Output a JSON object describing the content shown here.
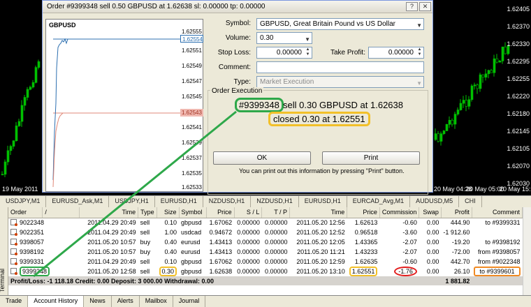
{
  "dialog": {
    "title": "Order #9399348 sell 0.50 GBPUSD at 1.62638 sl: 0.00000 tp: 0.00000",
    "labels": {
      "symbol": "Symbol:",
      "volume": "Volume:",
      "stop_loss": "Stop Loss:",
      "take_profit": "Take Profit:",
      "comment": "Comment:",
      "type": "Type:"
    },
    "symbol_value": "GBPUSD, Great Britain Pound vs US Dollar",
    "volume_value": "0.30",
    "stop_loss_value": "0.00000",
    "take_profit_value": "0.00000",
    "comment_value": "",
    "type_value": "Market Execution",
    "execution_legend": "Order Execution",
    "order_number": "#9399348",
    "order_rest": "sell 0.30 GBPUSD at 1.62638",
    "closed_text": "closed 0.30 at 1.62551",
    "ok_label": "OK",
    "print_label": "Print",
    "print_note": "You can print out this information by pressing \"Print\" button.",
    "mini_chart": {
      "title": "GBPUSD",
      "prices": [
        "1.62555",
        "1.62554",
        "1.62551",
        "1.62549",
        "1.62547",
        "1.62545",
        "1.62543",
        "1.62541",
        "1.62539",
        "1.62537",
        "1.62535",
        "1.62533"
      ],
      "ask_tag": "1.62554",
      "bid_tag": "1.62543"
    }
  },
  "background_chart": {
    "prices": [
      "1.62405",
      "1.62370",
      "1.62330",
      "1.62295",
      "1.62255",
      "1.62220",
      "1.62180",
      "1.62145",
      "1.62105",
      "1.62070",
      "1.62030"
    ],
    "date_left": "19 May 2011",
    "date_right_1": "20 May 04:28",
    "date_right_2": "20 May 05:00",
    "date_right_3": "20 May 15:",
    "colors": {
      "bull": "#00c000",
      "bear": "#00c000",
      "background": "#000000"
    }
  },
  "chart_tabs": [
    "USDJPY,M1",
    "EURUSD_Ask,M1",
    "USDJPY,H1",
    "EURUSD,H1",
    "NZDUSD,H1",
    "NZDUSD,H1",
    "EURUSD,H1",
    "EURCAD_Avg,M1",
    "AUDUSD,M5",
    "CHI"
  ],
  "table": {
    "headers": [
      "Order",
      "/",
      "Time",
      "Type",
      "Size",
      "Symbol",
      "Price",
      "S / L",
      "T / P",
      "Time",
      "Price",
      "Commission",
      "Swap",
      "Profit",
      "Comment"
    ],
    "rows": [
      {
        "order": "9022348",
        "time": "2011.04.29 20:49",
        "type": "sell",
        "size": "0.10",
        "symbol": "gbpusd",
        "price": "1.67062",
        "sl": "0.00000",
        "tp": "0.00000",
        "ctime": "2011.05.20 12:56",
        "cprice": "1.62613",
        "commission": "-0.60",
        "swap": "0.00",
        "profit": "444.90",
        "comment": "to #9399331"
      },
      {
        "order": "9022351",
        "time": "2011.04.29 20:49",
        "type": "sell",
        "size": "1.00",
        "symbol": "usdcad",
        "price": "0.94672",
        "sl": "0.00000",
        "tp": "0.00000",
        "ctime": "2011.05.20 12:52",
        "cprice": "0.96518",
        "commission": "-3.60",
        "swap": "0.00",
        "profit": "-1 912.60",
        "comment": ""
      },
      {
        "order": "9398057",
        "time": "2011.05.20 10:57",
        "type": "buy",
        "size": "0.40",
        "symbol": "eurusd",
        "price": "1.43413",
        "sl": "0.00000",
        "tp": "0.00000",
        "ctime": "2011.05.20 12:05",
        "cprice": "1.43365",
        "commission": "-2.07",
        "swap": "0.00",
        "profit": "-19.20",
        "comment": "to #9398192"
      },
      {
        "order": "9398192",
        "time": "2011.05.20 10:57",
        "type": "buy",
        "size": "0.40",
        "symbol": "eurusd",
        "price": "1.43413",
        "sl": "0.00000",
        "tp": "0.00000",
        "ctime": "2011.05.20 11:21",
        "cprice": "1.43233",
        "commission": "-2.07",
        "swap": "0.00",
        "profit": "-72.00",
        "comment": "from #9398057"
      },
      {
        "order": "9399331",
        "time": "2011.04.29 20:49",
        "type": "sell",
        "size": "0.10",
        "symbol": "gbpusd",
        "price": "1.67062",
        "sl": "0.00000",
        "tp": "0.00000",
        "ctime": "2011.05.20 12:59",
        "cprice": "1.62635",
        "commission": "-0.60",
        "swap": "0.00",
        "profit": "442.70",
        "comment": "from #9022348"
      },
      {
        "order": "9399348",
        "time": "2011.05.20 12:58",
        "type": "sell",
        "size": "0.30",
        "symbol": "gbpusd",
        "price": "1.62638",
        "sl": "0.00000",
        "tp": "0.00000",
        "ctime": "2011.05.20 13:10",
        "cprice": "1.62551",
        "commission": "-1.76",
        "swap": "0.00",
        "profit": "26.10",
        "comment": "to #9399601"
      }
    ],
    "total": {
      "text": "Profit/Loss: -1 118.18  Credit: 0.00  Deposit: 3 000.00  Withdrawal: 0.00",
      "profit": "1 881.82"
    }
  },
  "bottom_tabs": [
    "Trade",
    "Account History",
    "News",
    "Alerts",
    "Mailbox",
    "Journal"
  ],
  "terminal_label": "Terminal"
}
